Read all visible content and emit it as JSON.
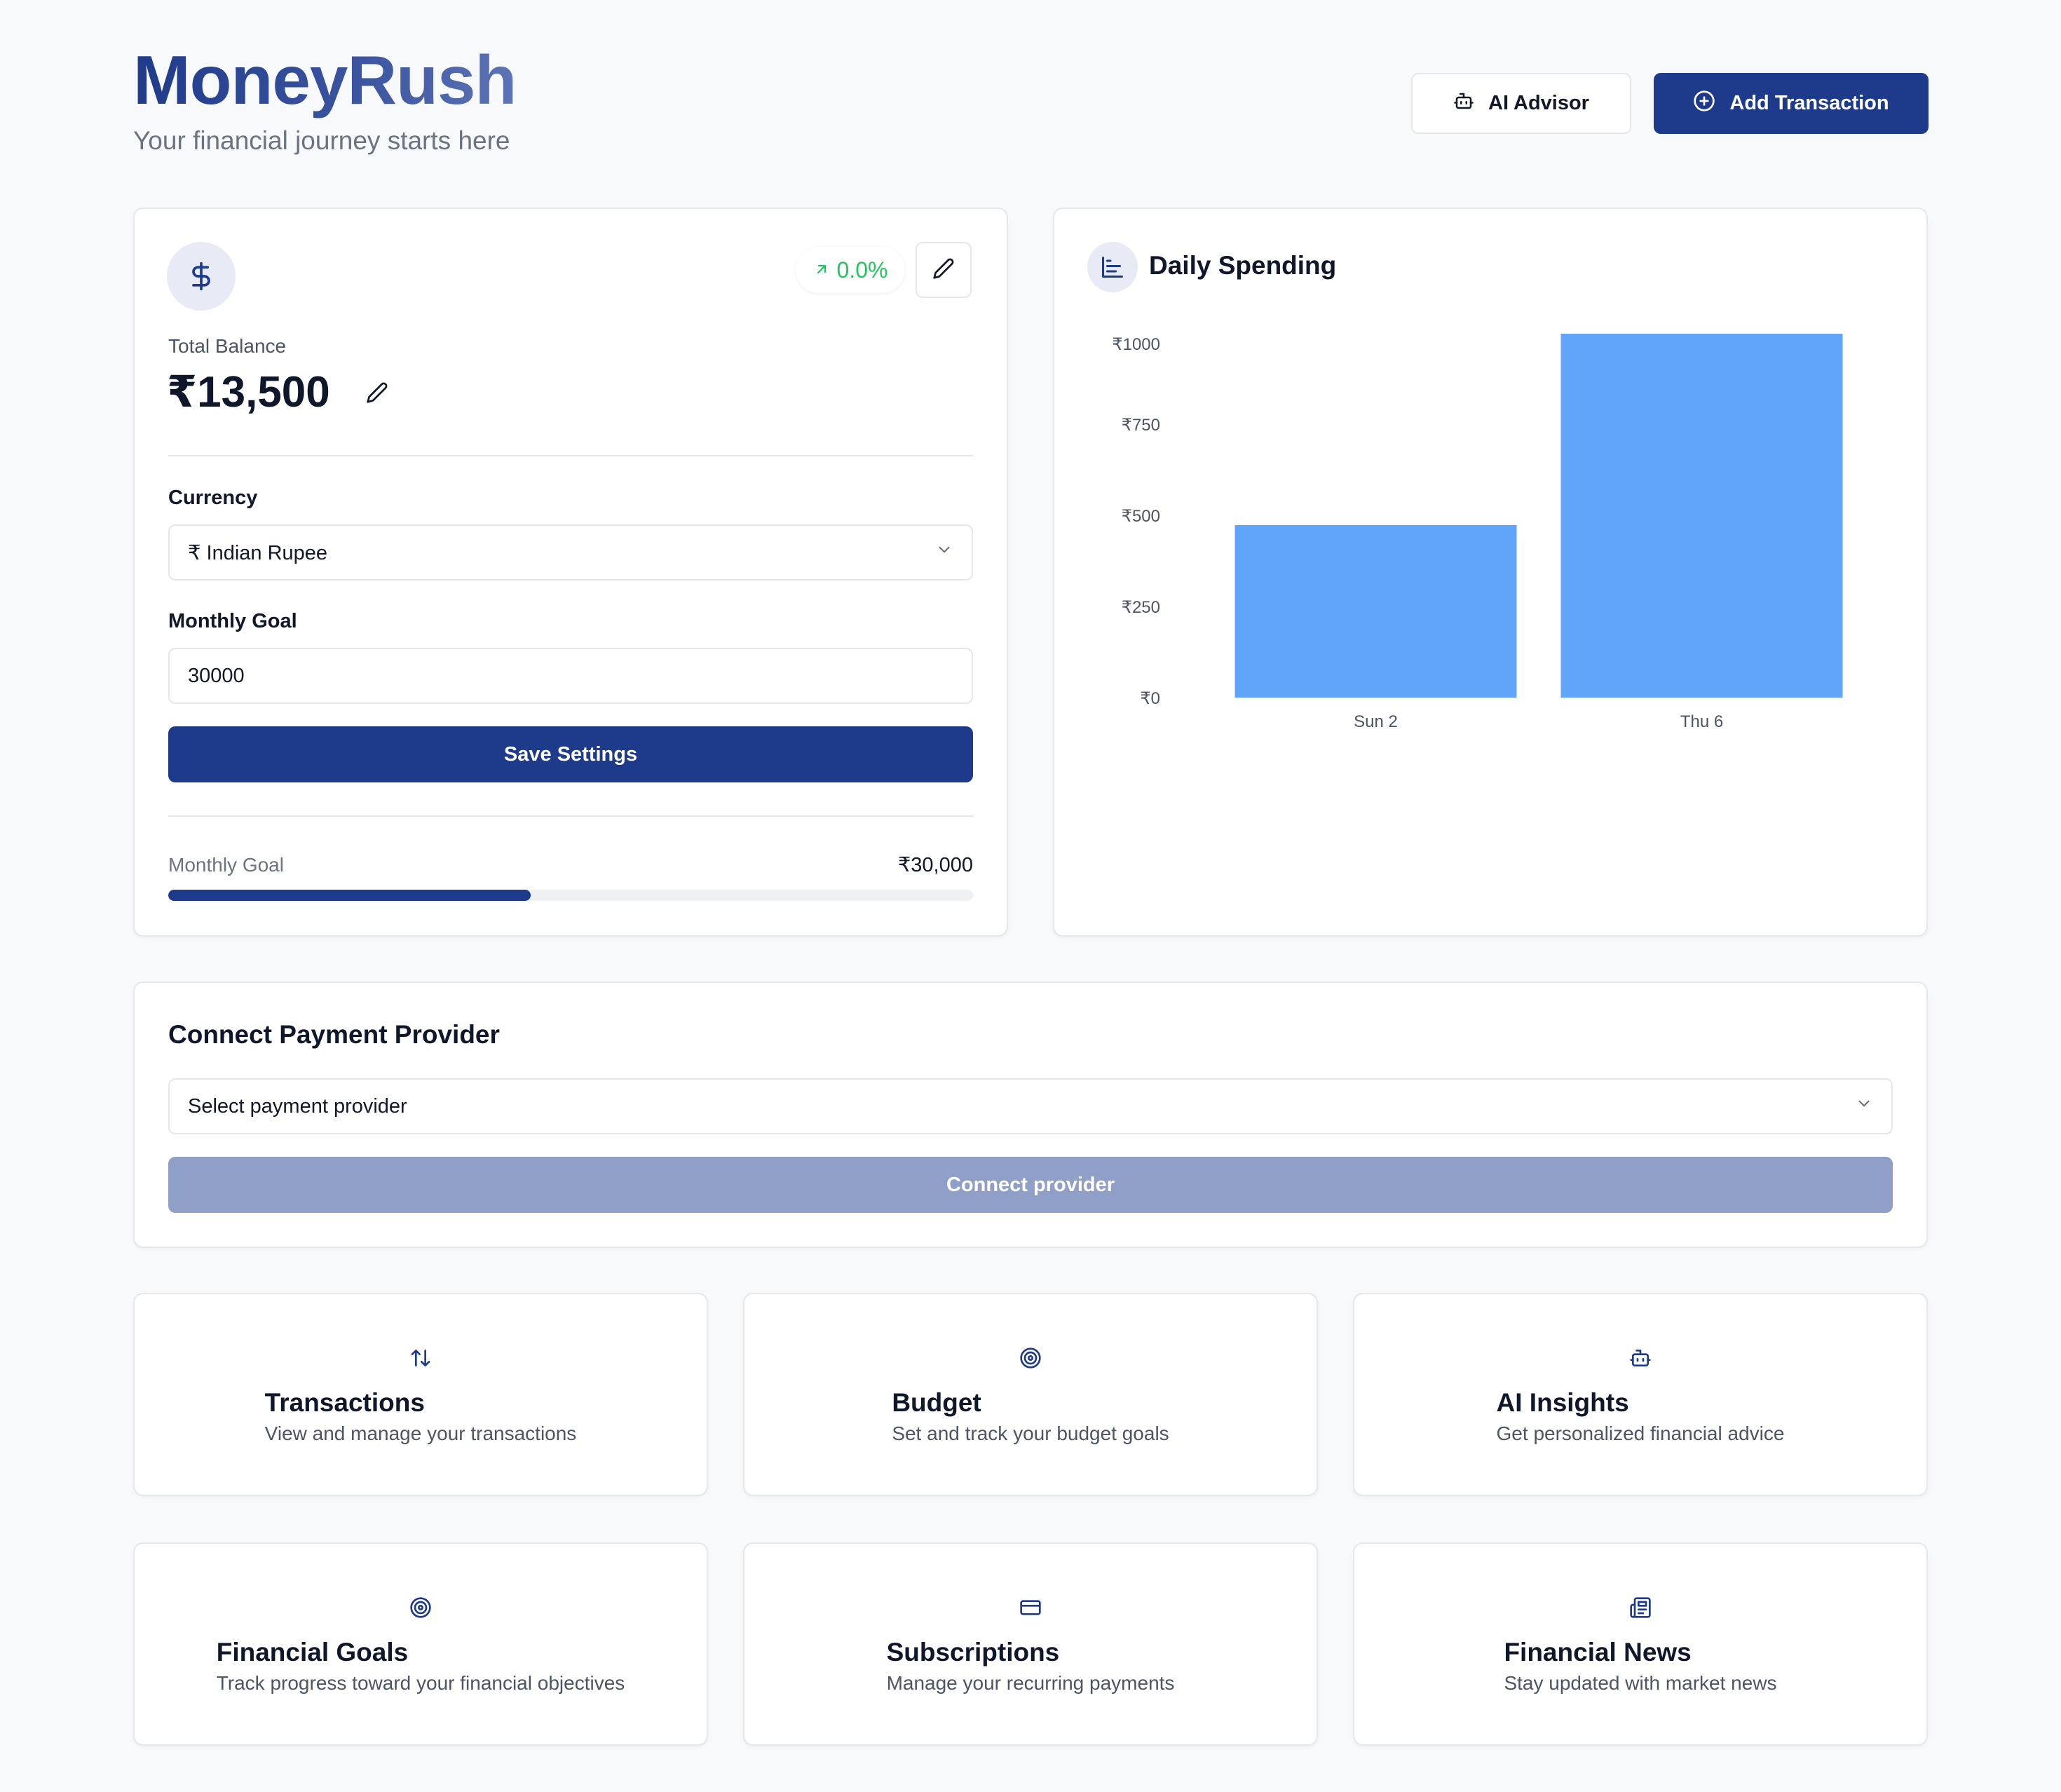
{
  "header": {
    "brand": "MoneyRush",
    "tagline": "Your financial journey starts here",
    "ai_advisor_label": "AI Advisor",
    "add_transaction_label": "Add Transaction"
  },
  "balance_card": {
    "trend": "0.0%",
    "total_balance_label": "Total Balance",
    "total_balance_value": "₹13,500",
    "currency_label": "Currency",
    "currency_value": "₹ Indian Rupee",
    "monthly_goal_label": "Monthly Goal",
    "monthly_goal_value": "30000",
    "save_label": "Save Settings",
    "progress_label": "Monthly Goal",
    "progress_target": "₹30,000",
    "progress_fraction": 0.45
  },
  "chart_card": {
    "title": "Daily Spending"
  },
  "chart_data": {
    "type": "bar",
    "title": "Daily Spending",
    "categories": [
      "Sun 2",
      "Thu 6"
    ],
    "values": [
      500,
      1000
    ],
    "y_ticks": [
      "₹0",
      "₹250",
      "₹500",
      "₹750",
      "₹1000"
    ],
    "ylim": [
      0,
      1000
    ],
    "bar_color": "#60a5fa",
    "grid": false
  },
  "provider": {
    "title": "Connect Payment Provider",
    "select_placeholder": "Select payment provider",
    "connect_label": "Connect provider"
  },
  "tiles": [
    {
      "icon": "arrows-up-down-icon",
      "title": "Transactions",
      "subtitle": "View and manage your transactions"
    },
    {
      "icon": "target-icon",
      "title": "Budget",
      "subtitle": "Set and track your budget goals"
    },
    {
      "icon": "robot-icon",
      "title": "AI Insights",
      "subtitle": "Get personalized financial advice"
    },
    {
      "icon": "target-icon",
      "title": "Financial Goals",
      "subtitle": "Track progress toward your financial objectives"
    },
    {
      "icon": "credit-card-icon",
      "title": "Subscriptions",
      "subtitle": "Manage your recurring payments"
    },
    {
      "icon": "newspaper-icon",
      "title": "Financial News",
      "subtitle": "Stay updated with market news"
    }
  ],
  "colors": {
    "primary": "#1e3a8a",
    "accent_bar": "#60a5fa",
    "trend_green": "#22c55e",
    "disabled_button": "#909fc7"
  }
}
